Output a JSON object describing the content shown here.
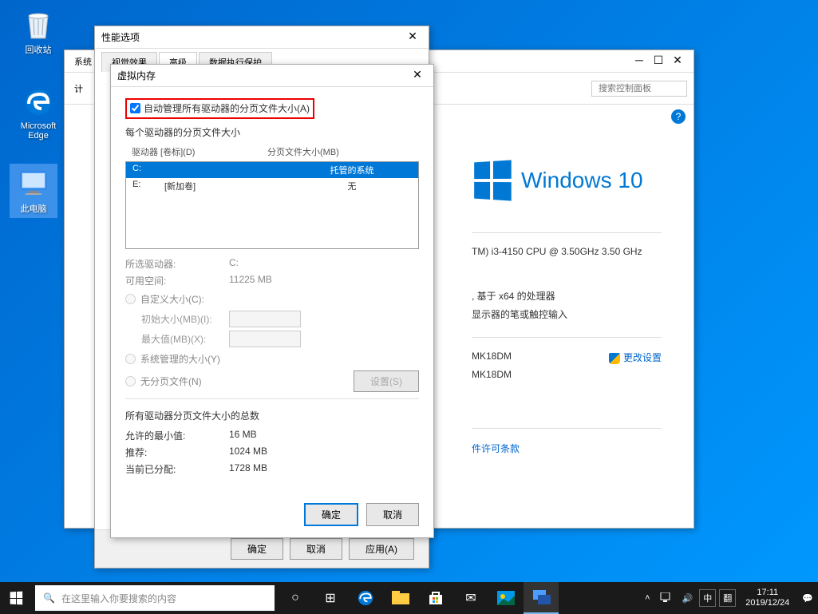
{
  "desktop": {
    "recycle": "回收站",
    "edge": "Microsoft Edge",
    "pc": "此电脑"
  },
  "control_panel": {
    "title_prefix": "系统",
    "search_placeholder": "搜索控制面板",
    "logo_text": "Windows 10",
    "cpu": "TM) i3-4150 CPU @ 3.50GHz   3.50 GHz",
    "arch": ", 基于 x64 的处理器",
    "pen": "显示器的笔或触控输入",
    "change_settings": "更改设置",
    "comp_name": "MK18DM",
    "comp_name2": "MK18DM",
    "license": "件许可条款",
    "sub_title": "计"
  },
  "perf": {
    "title": "性能选项",
    "tabs": [
      "视觉效果",
      "高级",
      "数据执行保护"
    ],
    "ok": "确定",
    "cancel": "取消",
    "apply": "应用(A)"
  },
  "vm": {
    "title": "虚拟内存",
    "auto_manage": "自动管理所有驱动器的分页文件大小(A)",
    "each_drive": "每个驱动器的分页文件大小",
    "drive_label": "驱动器 [卷标](D)",
    "paging_size": "分页文件大小(MB)",
    "drives": [
      {
        "letter": "C:",
        "label": "",
        "size": "托管的系统",
        "selected": true
      },
      {
        "letter": "E:",
        "label": "[新加卷]",
        "size": "无",
        "selected": false
      }
    ],
    "selected_drive_lbl": "所选驱动器:",
    "selected_drive_val": "C:",
    "available_lbl": "可用空间:",
    "available_val": "11225 MB",
    "custom_size": "自定义大小(C):",
    "initial_size": "初始大小(MB)(I):",
    "max_size": "最大值(MB)(X):",
    "system_managed": "系统管理的大小(Y)",
    "no_paging": "无分页文件(N)",
    "set_btn": "设置(S)",
    "totals_header": "所有驱动器分页文件大小的总数",
    "min_allowed_lbl": "允许的最小值:",
    "min_allowed_val": "16 MB",
    "recommended_lbl": "推荐:",
    "recommended_val": "1024 MB",
    "current_lbl": "当前已分配:",
    "current_val": "1728 MB",
    "ok": "确定",
    "cancel": "取消"
  },
  "taskbar": {
    "search_placeholder": "在这里输入你要搜索的内容",
    "ime1": "中",
    "ime2": "翻",
    "time": "17:11",
    "date": "2019/12/24"
  }
}
